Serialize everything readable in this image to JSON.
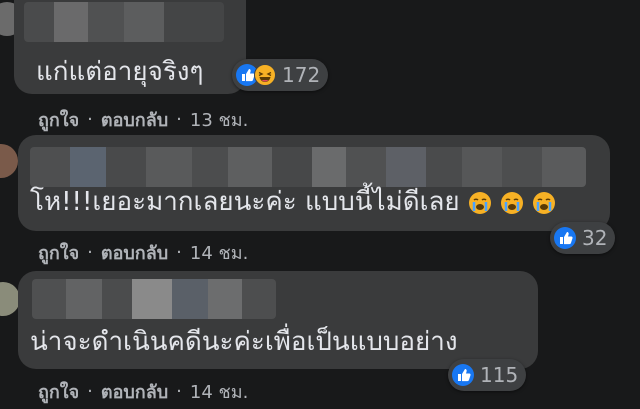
{
  "comments": [
    {
      "text": "แก่แต่อายุจริงๆ",
      "reaction_count": "172",
      "like_label": "ถูกใจ",
      "reply_label": "ตอบกลับ",
      "time": "13 ชม.",
      "reactions": [
        "like-icon",
        "laugh-icon"
      ]
    },
    {
      "text": "โห!!!เยอะมากเลยนะค่ะ แบบนี้ไม่ดีเลย",
      "emojis": [
        "crying-face-icon",
        "crying-face-icon",
        "crying-face-icon"
      ],
      "reaction_count": "32",
      "like_label": "ถูกใจ",
      "reply_label": "ตอบกลับ",
      "time": "14 ชม.",
      "reactions": [
        "like-icon"
      ]
    },
    {
      "text": "น่าจะดำเนินคดีนะค่ะเพื่อเป็นแบบอย่าง",
      "reaction_count": "115",
      "like_label": "ถูกใจ",
      "reply_label": "ตอบกลับ",
      "time": "14 ชม.",
      "reactions": [
        "like-icon"
      ]
    }
  ],
  "separator": "·",
  "colors": {
    "background": "#18191a",
    "bubble": "#3a3b3c",
    "text": "#e4e6eb",
    "secondary_text": "#b0b3b8",
    "like_blue": "#1877f2"
  }
}
